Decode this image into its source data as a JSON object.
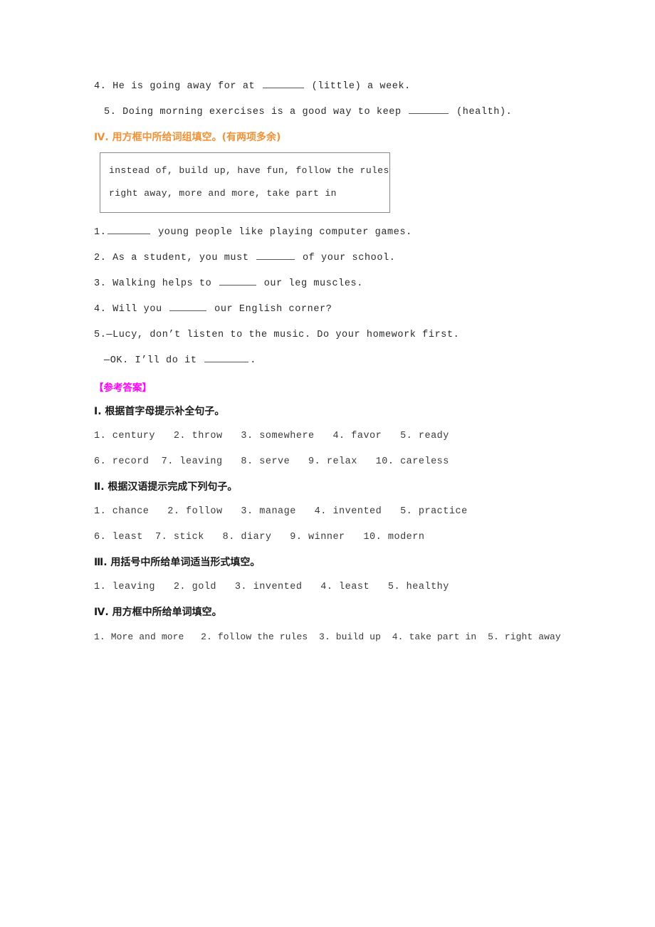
{
  "document": {
    "type": "worksheet-answer-key",
    "colors": {
      "heading_orange": "#F09135",
      "answers_magenta": "#FF00FF",
      "body_text": "#2a2a2a",
      "box_border": "#8a8a8a"
    }
  },
  "exercise_tail": {
    "items": [
      {
        "number": "4.",
        "before": " He is going away for at ",
        "after": " (little) a week."
      },
      {
        "number": "5.",
        "before": " Doing morning exercises is a good way to keep ",
        "after": " (health)."
      }
    ]
  },
  "section_iv": {
    "heading": "Ⅳ. 用方框中所给词组填空。(有两项多余)",
    "word_box": {
      "line1": "instead of, build up, have fun, follow the rules",
      "line2": "right away, more and more, take part in"
    },
    "items": [
      {
        "number": "1.",
        "before": "",
        "after": " young people like playing computer games."
      },
      {
        "number": "2.",
        "before": " As a student, you must ",
        "after": " of your school."
      },
      {
        "number": "3.",
        "before": " Walking helps to ",
        "after": " our leg muscles."
      },
      {
        "number": "4.",
        "before": " Will you ",
        "after": " our English corner?"
      },
      {
        "number": "5.",
        "before": "—Lucy, don’t listen to the music. Do your homework first.",
        "after": ""
      }
    ],
    "item5_reply": {
      "before": "—OK. I’ll do it ",
      "after": "."
    }
  },
  "answer_key": {
    "title": "【参考答案】",
    "sections": [
      {
        "heading": "Ⅰ. 根据首字母提示补全句子。",
        "lines": [
          "1. century   2. throw   3. somewhere   4. favor   5. ready",
          "6. record  7. leaving   8. serve   9. relax   10. careless"
        ]
      },
      {
        "heading": "Ⅱ. 根据汉语提示完成下列句子。",
        "lines": [
          "1. chance   2. follow   3. manage   4. invented   5. practice",
          "6. least  7. stick   8. diary   9. winner   10. modern"
        ]
      },
      {
        "heading": "Ⅲ. 用括号中所给单词适当形式填空。",
        "lines": [
          "1. leaving   2. gold   3. invented   4. least   5. healthy"
        ]
      },
      {
        "heading": "Ⅳ. 用方框中所给单词填空。",
        "lines": [
          "1. More and more   2. follow the rules  3. build up  4. take part in  5. right away"
        ]
      }
    ]
  }
}
